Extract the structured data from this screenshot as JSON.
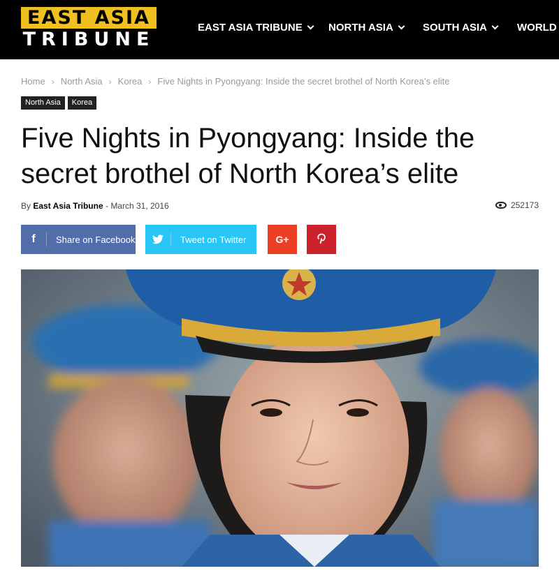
{
  "header": {
    "logo_top": "EAST ASIA",
    "logo_bottom": "TRIBUNE",
    "nav": [
      {
        "label": "EAST ASIA TRIBUNE"
      },
      {
        "label": "NORTH ASIA"
      },
      {
        "label": "SOUTH ASIA"
      },
      {
        "label": "WORLD"
      }
    ]
  },
  "breadcrumb": {
    "items": [
      "Home",
      "North Asia",
      "Korea",
      "Five Nights in Pyongyang: Inside the secret brothel of North Korea’s elite"
    ]
  },
  "tags": [
    "North Asia",
    "Korea"
  ],
  "article": {
    "title": "Five Nights in Pyongyang: Inside the secret brothel of North Korea’s elite",
    "by": "By",
    "author": "East Asia Tribune",
    "date_sep": "-",
    "date": "March 31, 2016",
    "views": "252173"
  },
  "share": {
    "facebook_label": "Share on Facebook",
    "twitter_label": "Tweet on Twitter",
    "googleplus_label": "G+"
  },
  "colors": {
    "brand_yellow": "#f0c020",
    "facebook": "#516eab",
    "twitter": "#29c5f6",
    "googleplus": "#eb4026",
    "pinterest": "#ca212a"
  }
}
